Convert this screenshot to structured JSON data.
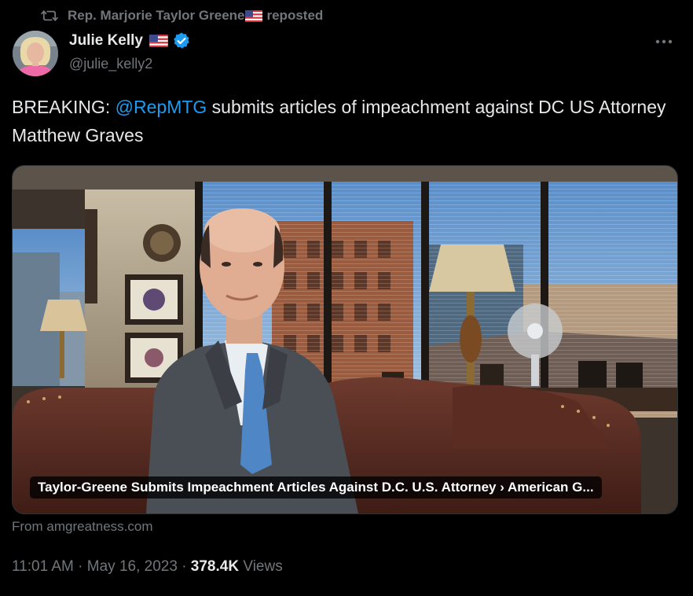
{
  "repost": {
    "reposter": "Rep. Marjorie Taylor Greene",
    "label": "reposted"
  },
  "author": {
    "name": "Julie Kelly",
    "handle": "@julie_kelly2",
    "verified": true
  },
  "tweet": {
    "text_prefix": "BREAKING: ",
    "mention": "@RepMTG",
    "text_suffix": " submits articles of impeachment against DC US Attorney Matthew Graves"
  },
  "card": {
    "title": "Taylor-Greene Submits Impeachment Articles Against D.C. U.S. Attorney › American G...",
    "source": "From amgreatness.com"
  },
  "meta": {
    "time": "11:01 AM",
    "separator": "·",
    "date": "May 16, 2023",
    "views_count": "378.4K",
    "views_label": "Views"
  },
  "colors": {
    "background": "#000000",
    "text_primary": "#e7e9ea",
    "text_secondary": "#71767b",
    "accent": "#1d9bf0",
    "verified": "#1d9bf0",
    "border": "#2f3336"
  },
  "icons": {
    "repost": "repost-icon",
    "flag": "us-flag-icon",
    "verified": "verified-badge-icon",
    "more": "more-options-icon"
  }
}
